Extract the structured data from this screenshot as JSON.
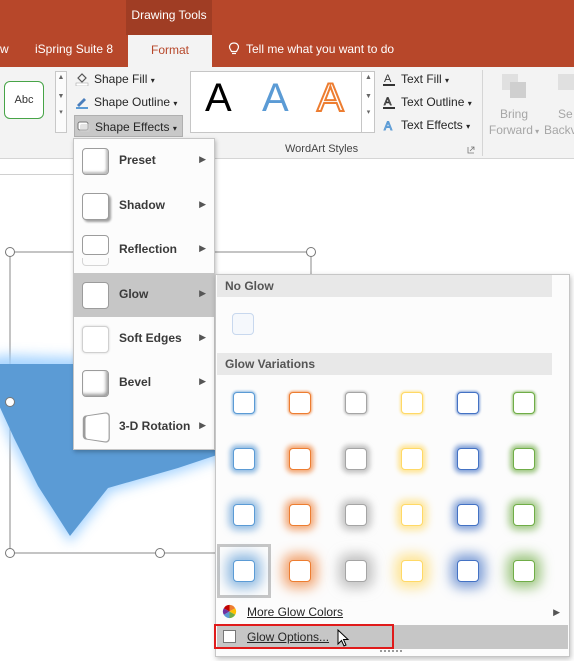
{
  "context_tab_title": "Drawing Tools",
  "tabs": {
    "partial": "w",
    "ispring": "iSpring Suite 8",
    "format": "Format",
    "tell_me": "Tell me what you want to do"
  },
  "ribbon": {
    "abc_sample": "Abc",
    "shape_fill": "Shape Fill",
    "shape_outline": "Shape Outline",
    "shape_effects": "Shape Effects",
    "text_fill": "Text Fill",
    "text_outline": "Text Outline",
    "text_effects": "Text Effects",
    "wordart_letter": "A",
    "wordart_group_label": "WordArt Styles",
    "bring_forward_1": "Bring",
    "bring_forward_2": "Forward",
    "send_backward_1": "Se",
    "send_backward_2": "Backv"
  },
  "shape_effects_menu": {
    "items": [
      {
        "label": "Preset"
      },
      {
        "label": "Shadow"
      },
      {
        "label": "Reflection"
      },
      {
        "label": "Glow"
      },
      {
        "label": "Soft Edges"
      },
      {
        "label": "Bevel"
      },
      {
        "label": "3-D Rotation"
      }
    ]
  },
  "glow_menu": {
    "no_glow_header": "No Glow",
    "variations_header": "Glow Variations",
    "colors": [
      "#5b9bd5",
      "#ed7d31",
      "#a5a5a5",
      "#ffd966",
      "#4472c4",
      "#70ad47"
    ],
    "more_colors": "More Glow Colors",
    "glow_options": "Glow Options..."
  },
  "colors": {
    "title_bar": "#b7472a",
    "accent_red": "#e01b1b",
    "star_blue": "#5b9bd5"
  }
}
